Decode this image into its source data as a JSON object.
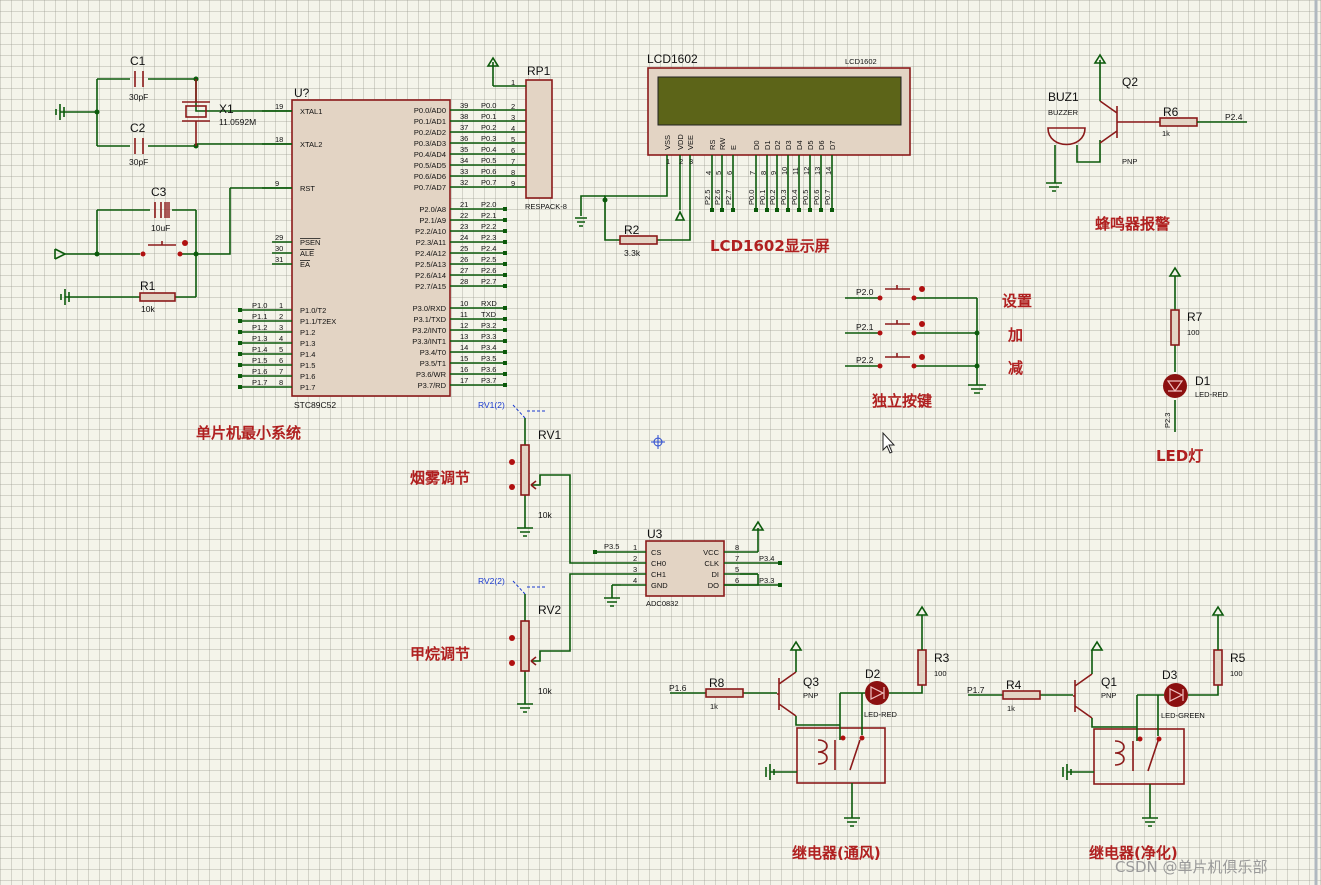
{
  "titles": {
    "mcu": "单片机最小系统",
    "lcd": "LCD1602显示屏",
    "buzzer": "蜂鸣器报警",
    "buttons": "独立按键",
    "led": "LED灯",
    "smoke": "烟雾调节",
    "methane": "甲烷调节",
    "relay_vent": "继电器(通风)",
    "relay_purify": "继电器(净化)",
    "btn_set": "设置",
    "btn_add": "加",
    "btn_sub": "减"
  },
  "watermark": "CSDN @单片机俱乐部",
  "mcu": {
    "ref": "U?",
    "part": "STC89C52",
    "left_pins": [
      {
        "num": "19",
        "name": "XTAL1"
      },
      {
        "num": "18",
        "name": "XTAL2"
      },
      {
        "num": "9",
        "name": "RST"
      },
      {
        "num": "29",
        "name": "PSEN"
      },
      {
        "num": "30",
        "name": "ALE"
      },
      {
        "num": "31",
        "name": "EA"
      }
    ],
    "p1_pins": [
      {
        "num": "1",
        "name": "P1.0/T2",
        "net": "P1.0"
      },
      {
        "num": "2",
        "name": "P1.1/T2EX",
        "net": "P1.1"
      },
      {
        "num": "3",
        "name": "P1.2",
        "net": "P1.2"
      },
      {
        "num": "4",
        "name": "P1.3",
        "net": "P1.3"
      },
      {
        "num": "5",
        "name": "P1.4",
        "net": "P1.4"
      },
      {
        "num": "6",
        "name": "P1.5",
        "net": "P1.5"
      },
      {
        "num": "7",
        "name": "P1.6",
        "net": "P1.6"
      },
      {
        "num": "8",
        "name": "P1.7",
        "net": "P1.7"
      }
    ],
    "p0_pins": [
      {
        "num": "39",
        "name": "P0.0/AD0",
        "net": "P0.0"
      },
      {
        "num": "38",
        "name": "P0.1/AD1",
        "net": "P0.1"
      },
      {
        "num": "37",
        "name": "P0.2/AD2",
        "net": "P0.2"
      },
      {
        "num": "36",
        "name": "P0.3/AD3",
        "net": "P0.3"
      },
      {
        "num": "35",
        "name": "P0.4/AD4",
        "net": "P0.4"
      },
      {
        "num": "34",
        "name": "P0.5/AD5",
        "net": "P0.5"
      },
      {
        "num": "33",
        "name": "P0.6/AD6",
        "net": "P0.6"
      },
      {
        "num": "32",
        "name": "P0.7/AD7",
        "net": "P0.7"
      }
    ],
    "p2_pins": [
      {
        "num": "21",
        "name": "P2.0/A8",
        "net": "P2.0"
      },
      {
        "num": "22",
        "name": "P2.1/A9",
        "net": "P2.1"
      },
      {
        "num": "23",
        "name": "P2.2/A10",
        "net": "P2.2"
      },
      {
        "num": "24",
        "name": "P2.3/A11",
        "net": "P2.3"
      },
      {
        "num": "25",
        "name": "P2.4/A12",
        "net": "P2.4"
      },
      {
        "num": "26",
        "name": "P2.5/A13",
        "net": "P2.5"
      },
      {
        "num": "27",
        "name": "P2.6/A14",
        "net": "P2.6"
      },
      {
        "num": "28",
        "name": "P2.7/A15",
        "net": "P2.7"
      }
    ],
    "p3_pins": [
      {
        "num": "10",
        "name": "P3.0/RXD",
        "net": "RXD"
      },
      {
        "num": "11",
        "name": "P3.1/TXD",
        "net": "TXD"
      },
      {
        "num": "12",
        "name": "P3.2/INT0",
        "net": "P3.2"
      },
      {
        "num": "13",
        "name": "P3.3/INT1",
        "net": "P3.3"
      },
      {
        "num": "14",
        "name": "P3.4/T0",
        "net": "P3.4"
      },
      {
        "num": "15",
        "name": "P3.5/T1",
        "net": "P3.5"
      },
      {
        "num": "16",
        "name": "P3.6/WR",
        "net": "P3.6"
      },
      {
        "num": "17",
        "name": "P3.7/RD",
        "net": "P3.7"
      }
    ]
  },
  "parts": {
    "c1": {
      "ref": "C1",
      "value": "30pF"
    },
    "c2": {
      "ref": "C2",
      "value": "30pF"
    },
    "c3": {
      "ref": "C3",
      "value": "10uF"
    },
    "x1": {
      "ref": "X1",
      "value": "11.0592M"
    },
    "r1": {
      "ref": "R1",
      "value": "10k"
    },
    "rp1": {
      "ref": "RP1",
      "value": "RESPACK-8",
      "pin1": "1",
      "pins": [
        "2",
        "3",
        "4",
        "5",
        "6",
        "7",
        "8",
        "9"
      ]
    },
    "r2": {
      "ref": "R2",
      "value": "3.3k"
    },
    "lcd": {
      "ref": "LCD1602",
      "tag": "LCD1602",
      "pins": [
        "VSS",
        "VDD",
        "VEE",
        "RS",
        "RW",
        "E",
        "D0",
        "D1",
        "D2",
        "D3",
        "D4",
        "D5",
        "D6",
        "D7"
      ],
      "nums": [
        "1",
        "2",
        "3",
        "4",
        "5",
        "6",
        "7",
        "8",
        "9",
        "10",
        "11",
        "12",
        "13",
        "14"
      ],
      "nets": [
        "P2.5",
        "P2.6",
        "P2.7",
        "P0.0",
        "P0.1",
        "P0.2",
        "P0.3",
        "P0.4",
        "P0.5",
        "P0.6",
        "P0.7"
      ]
    },
    "buz1": {
      "ref": "BUZ1",
      "value": "BUZZER"
    },
    "q2": {
      "ref": "Q2",
      "value": "PNP"
    },
    "r6": {
      "ref": "R6",
      "value": "1k",
      "net": "P2.4"
    },
    "r7": {
      "ref": "R7",
      "value": "100"
    },
    "d1": {
      "ref": "D1",
      "value": "LED-RED",
      "net": "P2.3"
    },
    "rv1": {
      "ref": "RV1",
      "value": "10k",
      "probe": "RV1(2)"
    },
    "rv2": {
      "ref": "RV2",
      "value": "10k",
      "probe": "RV2(2)"
    },
    "u3": {
      "ref": "U3",
      "value": "ADC0832",
      "left": [
        {
          "num": "1",
          "name": "CS",
          "net": "P3.5"
        },
        {
          "num": "2",
          "name": "CH0"
        },
        {
          "num": "3",
          "name": "CH1"
        },
        {
          "num": "4",
          "name": "GND"
        }
      ],
      "right": [
        {
          "num": "8",
          "name": "VCC"
        },
        {
          "num": "7",
          "name": "CLK",
          "net": "P3.4"
        },
        {
          "num": "5",
          "name": "DI"
        },
        {
          "num": "6",
          "name": "DO",
          "net": "P3.3"
        }
      ]
    },
    "r8": {
      "ref": "R8",
      "value": "1k",
      "net": "P1.6"
    },
    "q3": {
      "ref": "Q3",
      "value": "PNP"
    },
    "d2": {
      "ref": "D2",
      "value": "LED-RED"
    },
    "r3": {
      "ref": "R3",
      "value": "100"
    },
    "r4": {
      "ref": "R4",
      "value": "1k",
      "net": "P1.7"
    },
    "q1": {
      "ref": "Q1",
      "value": "PNP"
    },
    "d3": {
      "ref": "D3",
      "value": "LED-GREEN"
    },
    "r5": {
      "ref": "R5",
      "value": "100"
    },
    "buttons": {
      "nets": [
        "P2.0",
        "P2.1",
        "P2.2"
      ]
    }
  }
}
